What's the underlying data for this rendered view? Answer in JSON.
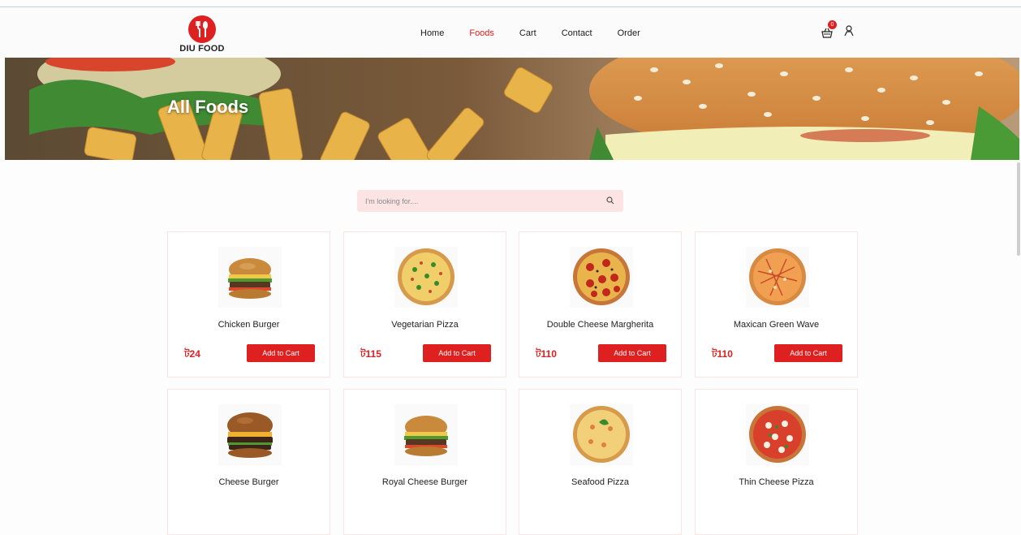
{
  "header": {
    "logo_text": "DIU FOOD",
    "nav": [
      {
        "label": "Home",
        "active": false
      },
      {
        "label": "Foods",
        "active": true
      },
      {
        "label": "Cart",
        "active": false
      },
      {
        "label": "Contact",
        "active": false
      },
      {
        "label": "Order",
        "active": false
      }
    ],
    "cart_count": "0",
    "icons": [
      "shopping-basket-icon",
      "user-icon"
    ]
  },
  "hero": {
    "title": "All Foods"
  },
  "search": {
    "placeholder": "I'm looking for....",
    "value": ""
  },
  "products": [
    {
      "name": "Chicken Burger",
      "price": "ট24",
      "button": "Add to Cart",
      "kind": "burger"
    },
    {
      "name": "Vegetarian Pizza",
      "price": "ট115",
      "button": "Add to Cart",
      "kind": "veg-pizza"
    },
    {
      "name": "Double Cheese Margherita",
      "price": "ট110",
      "button": "Add to Cart",
      "kind": "pepperoni-pizza"
    },
    {
      "name": "Maxican Green Wave",
      "price": "ট110",
      "button": "Add to Cart",
      "kind": "orange-pizza"
    },
    {
      "name": "Cheese Burger",
      "price": "",
      "button": "",
      "kind": "burger"
    },
    {
      "name": "Royal Cheese Burger",
      "price": "",
      "button": "",
      "kind": "burger"
    },
    {
      "name": "Seafood Pizza",
      "price": "",
      "button": "",
      "kind": "veg-pizza"
    },
    {
      "name": "Thin Cheese Pizza",
      "price": "",
      "button": "",
      "kind": "pepperoni-pizza"
    }
  ],
  "colors": {
    "accent": "#df2020",
    "search_bg": "#fde4e4",
    "card_border": "#fde4e4"
  }
}
